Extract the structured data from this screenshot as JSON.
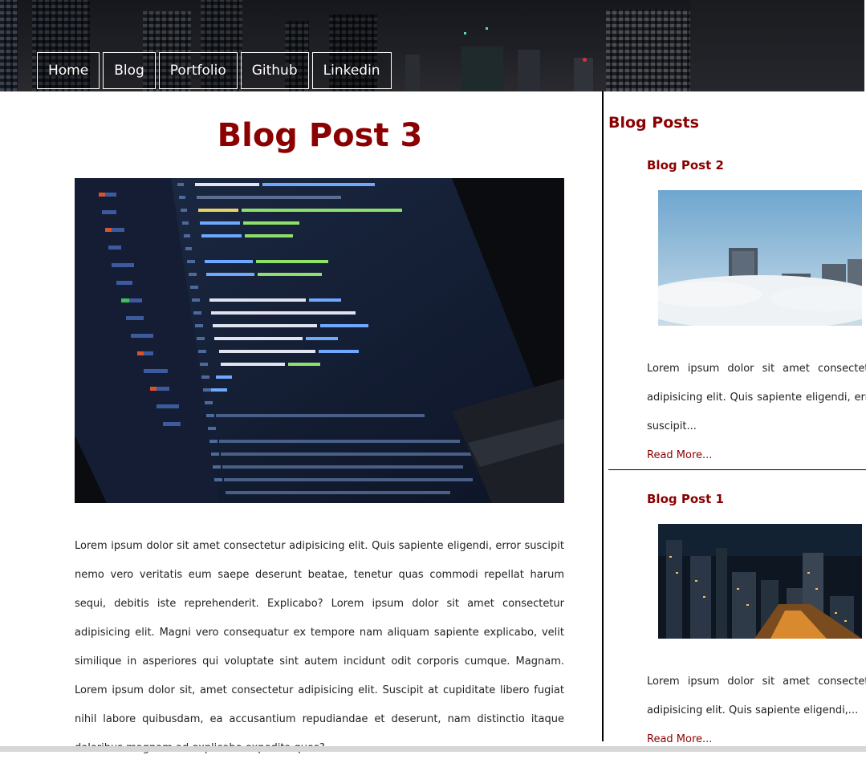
{
  "nav": {
    "items": [
      {
        "label": "Home"
      },
      {
        "label": "Blog"
      },
      {
        "label": "Portfolio"
      },
      {
        "label": "Github"
      },
      {
        "label": "Linkedin"
      }
    ]
  },
  "post": {
    "title": "Blog Post 3",
    "body": "Lorem ipsum dolor sit amet consectetur adipisicing elit. Quis sapiente eligendi, error suscipit nemo vero veritatis eum saepe deserunt beatae, tenetur quas commodi repellat harum sequi, debitis iste reprehenderit. Explicabo? Lorem ipsum dolor sit amet consectetur adipisicing elit. Magni vero consequatur ex tempore nam aliquam sapiente explicabo, velit similique in asperiores qui voluptate sint autem incidunt odit corporis cumque. Magnam. Lorem ipsum dolor sit, amet consectetur adipisicing elit. Suscipit at cupiditate libero fugiat nihil labore quibusdam, ea accusantium repudiandae et deserunt, nam distinctio itaque doloribus magnam ad explicabo expedita quos?"
  },
  "sidebar": {
    "heading": "Blog Posts",
    "posts": [
      {
        "title": "Blog Post 2",
        "excerpt": "Lorem ipsum dolor sit amet consectetur adipisicing elit. Quis sapiente eligendi, error suscipit...",
        "read_more": "Read More..."
      },
      {
        "title": "Blog Post 1",
        "excerpt": "Lorem ipsum dolor sit amet consectetur adipisicing elit. Quis sapiente eligendi,...",
        "read_more": "Read More..."
      }
    ]
  },
  "colors": {
    "accent": "#8b0000",
    "nav_text": "#ffffff",
    "header_bg": "#1c1d22"
  }
}
